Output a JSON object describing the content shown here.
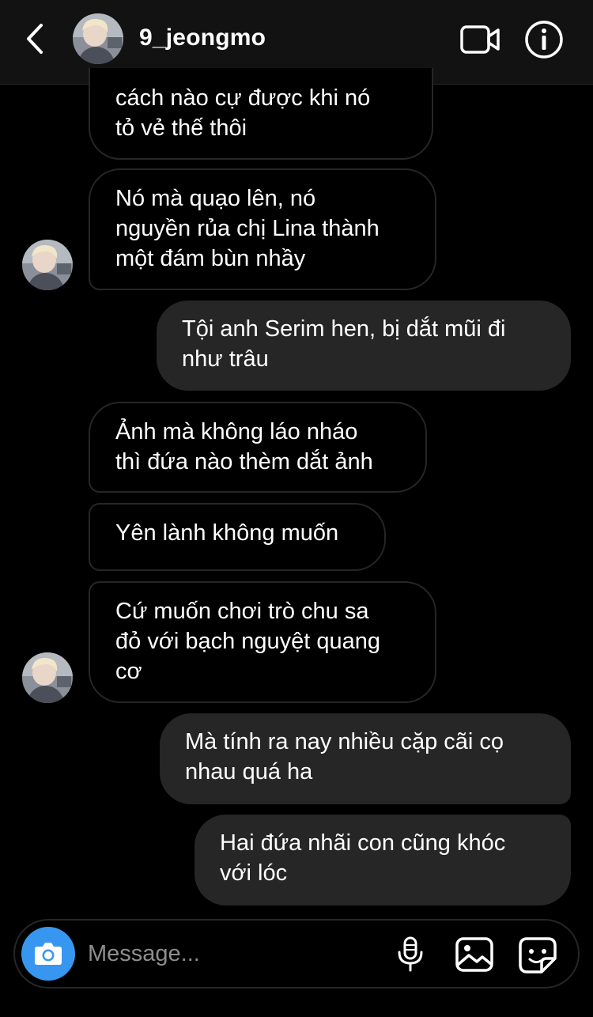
{
  "header": {
    "username": "9_jeongmo",
    "back_icon": "chevron-left-icon",
    "video_icon": "video-call-icon",
    "info_icon": "info-icon"
  },
  "messages": [
    {
      "direction": "incoming",
      "text": "cách nào cự được khi nó\ntỏ vẻ thế thôi"
    },
    {
      "direction": "incoming",
      "text": "Nó mà quạo lên, nó\nnguyền rủa chị Lina thành\nmột đám bùn nhầy"
    },
    {
      "direction": "outgoing",
      "text": "Tội anh Serim hen, bị dắt mũi đi\nnhư trâu"
    },
    {
      "direction": "incoming",
      "text": "Ảnh mà không láo nháo\nthì đứa nào thèm dắt ảnh"
    },
    {
      "direction": "incoming",
      "text": "Yên lành không muốn"
    },
    {
      "direction": "incoming",
      "text": "Cứ muốn chơi trò chu sa\nđỏ với bạch nguyệt quang\ncơ"
    },
    {
      "direction": "outgoing",
      "text": "Mà tính ra nay nhiều cặp cãi cọ\nnhau quá ha"
    },
    {
      "direction": "outgoing",
      "text": "Hai đứa nhãi con cũng khóc\nvới lóc"
    }
  ],
  "composer": {
    "placeholder": "Message...",
    "camera_icon": "camera-icon",
    "mic_icon": "microphone-icon",
    "gallery_icon": "image-gallery-icon",
    "sticker_icon": "sticker-icon"
  },
  "colors": {
    "background": "#000000",
    "header_bg": "#121212",
    "outgoing_bubble": "#262626",
    "incoming_border": "#262626",
    "accent": "#3797f0"
  }
}
